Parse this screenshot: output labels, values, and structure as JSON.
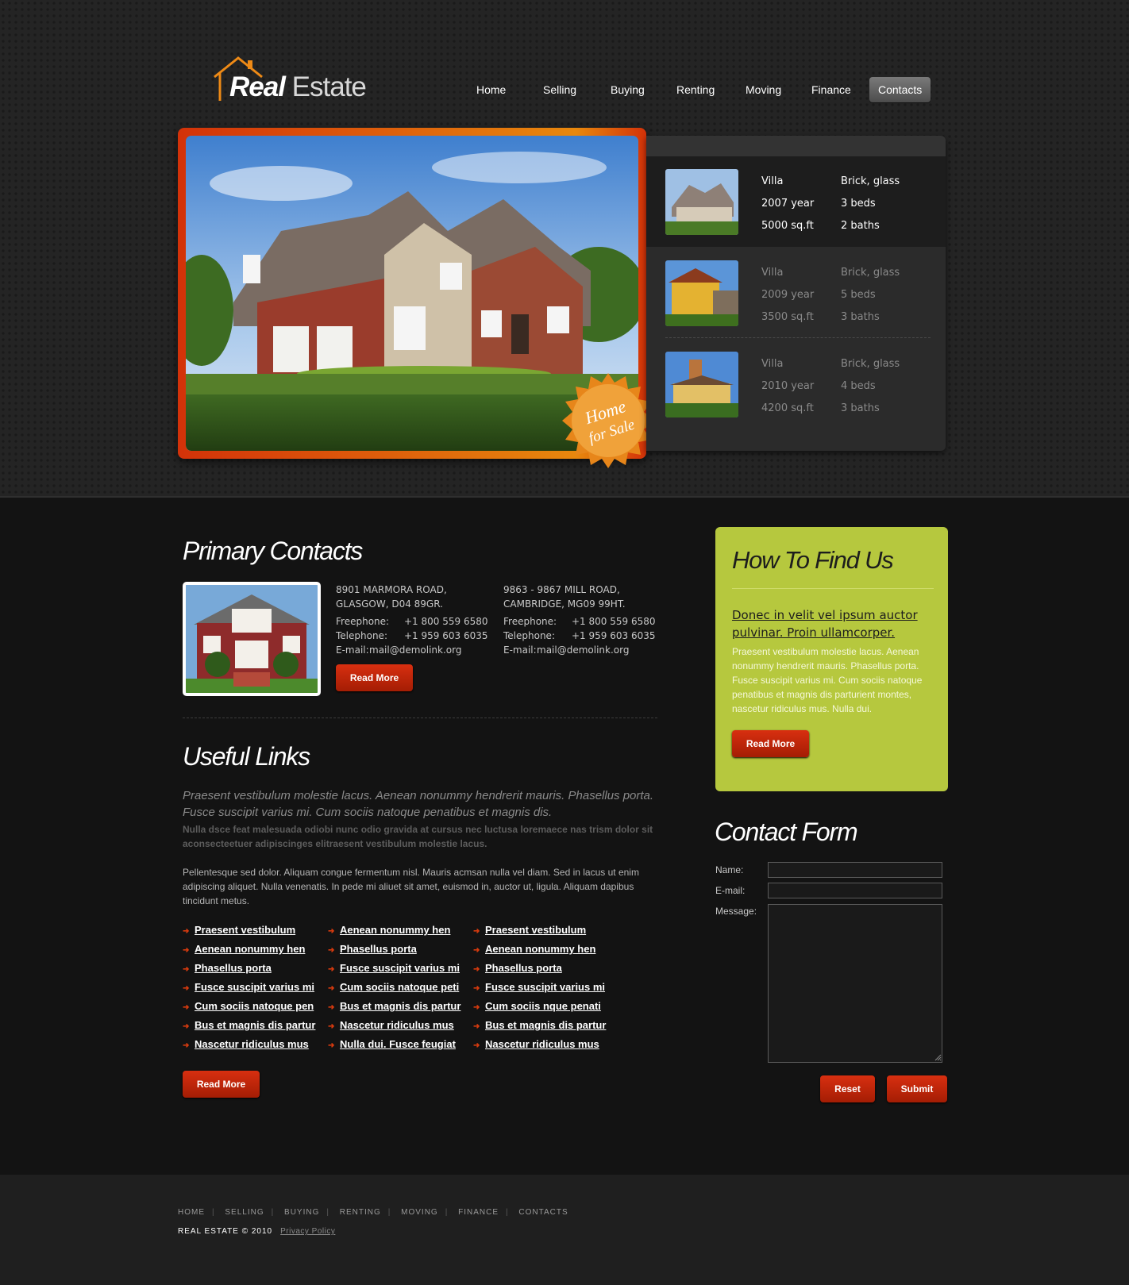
{
  "brand": {
    "name_bold": "Real",
    "name_light": "Estate"
  },
  "nav": [
    "Home",
    "Selling",
    "Buying",
    "Renting",
    "Moving",
    "Finance",
    "Contacts"
  ],
  "hero": {
    "badge_line1": "Home",
    "badge_line2": "for Sale"
  },
  "listings": [
    {
      "type": "Villa",
      "year": "2007 year",
      "area": "5000 sq.ft",
      "material": "Brick, glass",
      "beds": "3 beds",
      "baths": "2 baths"
    },
    {
      "type": "Villa",
      "year": "2009 year",
      "area": "3500 sq.ft",
      "material": "Brick, glass",
      "beds": "5 beds",
      "baths": "3 baths"
    },
    {
      "type": "Villa",
      "year": "2010 year",
      "area": "4200 sq.ft",
      "material": "Brick, glass",
      "beds": "4 beds",
      "baths": "3 baths"
    }
  ],
  "primary_contacts": {
    "title": "Primary Contacts",
    "addresses": [
      {
        "line1": "8901 MARMORA ROAD,",
        "line2": "GLASGOW, D04 89GR.",
        "freephone_label": "Freephone:",
        "freephone": "+1 800 559 6580",
        "telephone_label": "Telephone:",
        "telephone": "+1 959 603 6035",
        "email_label": "E-mail:",
        "email": "mail@demolink.org"
      },
      {
        "line1": "9863 - 9867 MILL ROAD,",
        "line2": "CAMBRIDGE, MG09 99HT.",
        "freephone_label": "Freephone:",
        "freephone": "+1 800 559 6580",
        "telephone_label": "Telephone:",
        "telephone": "+1 959 603 6035",
        "email_label": "E-mail:",
        "email": "mail@demolink.org"
      }
    ],
    "button": "Read More"
  },
  "useful_links": {
    "title": "Useful Links",
    "intro": "Praesent vestibulum molestie lacus. Aenean nonummy hendrerit mauris. Phasellus porta. Fusce suscipit varius mi. Cum sociis natoque penatibus et magnis dis.",
    "bold": "Nulla dsce feat malesuada odiobi nunc odio gravida at cursus nec luctusa loremaece nas trism dolor sit aconsecteetuer adipiscinges elitraesent vestibulum molestie lacus.",
    "paragraph": "Pellentesque sed dolor. Aliquam congue fermentum nisl. Mauris acmsan nulla vel diam. Sed in lacus ut enim adipiscing aliquet. Nulla venenatis. In pede mi aliuet sit amet, euismod in, auctor ut, ligula. Aliquam dapibus tincidunt metus.",
    "columns": [
      [
        "Praesent vestibulum",
        "Aenean nonummy hen",
        "Phasellus porta",
        "Fusce suscipit varius mi",
        "Cum sociis natoque pen",
        "Bus et magnis dis partur",
        "Nascetur ridiculus mus"
      ],
      [
        "Aenean nonummy hen",
        "Phasellus porta",
        "Fusce suscipit varius mi",
        "Cum sociis natoque peti",
        "Bus et magnis dis partur",
        "Nascetur ridiculus mus",
        "Nulla dui. Fusce feugiat"
      ],
      [
        "Praesent vestibulum",
        "Aenean nonummy hen",
        "Phasellus porta",
        "Fusce suscipit varius mi",
        "Cum sociis nque penati",
        "Bus et magnis dis partur",
        "Nascetur ridiculus mus"
      ]
    ],
    "button": "Read More"
  },
  "find_us": {
    "title": "How To Find Us",
    "headline": "Donec in velit vel ipsum auctor pulvinar. Proin ullamcorper.",
    "text": "Praesent vestibulum molestie lacus. Aenean nonummy hendrerit mauris. Phasellus porta. Fusce suscipit varius mi. Cum sociis natoque penatibus et magnis dis parturient montes, nascetur ridiculus mus. Nulla dui.",
    "button": "Read More"
  },
  "contact_form": {
    "title": "Contact Form",
    "name_label": "Name:",
    "email_label": "E-mail:",
    "message_label": "Message:",
    "name_value": "",
    "email_value": "",
    "message_value": "",
    "reset": "Reset",
    "submit": "Submit"
  },
  "footer": {
    "nav": [
      "HOME",
      "SELLING",
      "BUYING",
      "RENTING",
      "MOVING",
      "FINANCE",
      "CONTACTS"
    ],
    "copyright": "REAL ESTATE © 2010",
    "privacy": "Privacy Policy"
  },
  "colors": {
    "accent": "#c8280a",
    "hero_frame": "#e0600b",
    "green_box": "#b6c83e",
    "background": "#131313"
  }
}
